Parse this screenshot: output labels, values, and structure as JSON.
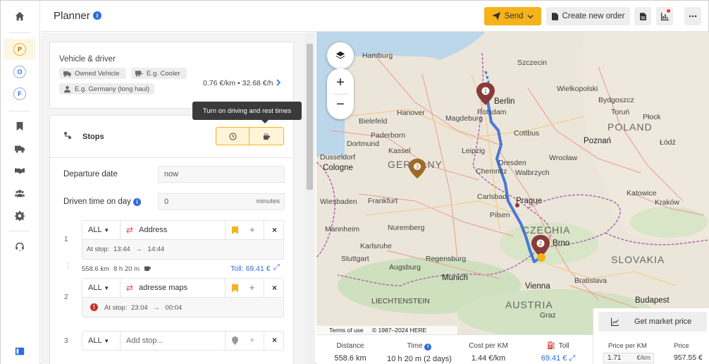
{
  "header": {
    "title": "Planner",
    "send_label": "Send",
    "create_order_label": "Create new order"
  },
  "rail": {
    "circles": [
      "P",
      "O",
      "F"
    ]
  },
  "vehicle": {
    "section_title": "Vehicle & driver",
    "chips": [
      "Owned Vehicle",
      "E.g. Cooler",
      "E.g. Germany (long haul)"
    ],
    "rate": "0.76 €/km • 32.68 €/h"
  },
  "stops": {
    "title": "Stops",
    "tooltip": "Turn on driving and rest times",
    "departure_label": "Departure date",
    "departure_value": "now",
    "driven_label": "Driven time on day",
    "driven_value": "0",
    "driven_unit": "minutes",
    "items": [
      {
        "num": "1",
        "type": "ALL",
        "address": "Address",
        "at_stop_label": "At stop:",
        "from": "13:44",
        "to": "14:44"
      },
      {
        "num": "2",
        "type": "ALL",
        "address": "adresse maps",
        "at_stop_label": "At stop:",
        "from": "23:04",
        "to": "00:04"
      },
      {
        "num": "3",
        "type": "ALL",
        "address": "",
        "placeholder": "Add stop..."
      }
    ],
    "leg": {
      "distance": "558.6 km",
      "time": "8 h 20 m",
      "toll": "Toll: 69.41 €"
    }
  },
  "map": {
    "attribution_terms": "Terms of use",
    "attribution_copy": "© 1987–2024 HERE",
    "marker_labels": [
      "1",
      "2",
      "3"
    ]
  },
  "summary": {
    "distance_label": "Distance",
    "distance_value": "558.6 km",
    "time_label": "Time",
    "time_value": "10 h 20 m  (2 days)",
    "cost_label": "Cost per KM",
    "cost_value": "1.44 €/km",
    "toll_label": "Toll",
    "toll_value": "69.41 €"
  },
  "market": {
    "button_label": "Get market price",
    "price_per_km_label": "Price per KM",
    "price_per_km_value": "1.71",
    "price_per_km_unit": "€/km",
    "price_label": "Price",
    "price_value": "957.55 €"
  },
  "colors": {
    "accent": "#f6b21a",
    "route": "#4a78d6",
    "marker": "#8a3a3a"
  }
}
